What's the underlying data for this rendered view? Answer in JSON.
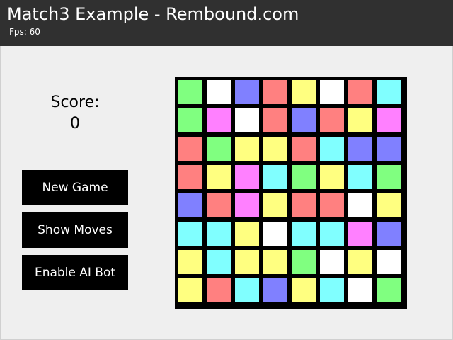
{
  "header": {
    "title": "Match3 Example - Rembound.com",
    "fps": "Fps: 60"
  },
  "sidebar": {
    "score_label": "Score:",
    "score_value": "0",
    "buttons": {
      "new_game": "New Game",
      "show_moves": "Show Moves",
      "enable_ai": "Enable AI Bot"
    }
  },
  "board": {
    "rows": 8,
    "cols": 8,
    "palette": {
      "green": "#80ff80",
      "white": "#ffffff",
      "blue": "#8080ff",
      "red": "#ff8080",
      "yellow": "#ffff80",
      "pink": "#ff80ff",
      "cyan": "#80ffff"
    },
    "tiles": [
      [
        "green",
        "white",
        "blue",
        "red",
        "yellow",
        "white",
        "red",
        "cyan"
      ],
      [
        "green",
        "pink",
        "white",
        "red",
        "blue",
        "red",
        "yellow",
        "pink"
      ],
      [
        "red",
        "green",
        "yellow",
        "yellow",
        "red",
        "cyan",
        "blue",
        "blue"
      ],
      [
        "red",
        "yellow",
        "pink",
        "cyan",
        "green",
        "yellow",
        "cyan",
        "green"
      ],
      [
        "blue",
        "red",
        "pink",
        "yellow",
        "red",
        "red",
        "white",
        "yellow"
      ],
      [
        "cyan",
        "cyan",
        "yellow",
        "white",
        "cyan",
        "cyan",
        "pink",
        "blue"
      ],
      [
        "yellow",
        "cyan",
        "yellow",
        "yellow",
        "green",
        "white",
        "yellow",
        "white"
      ],
      [
        "yellow",
        "red",
        "cyan",
        "blue",
        "yellow",
        "cyan",
        "white",
        "green"
      ]
    ]
  }
}
